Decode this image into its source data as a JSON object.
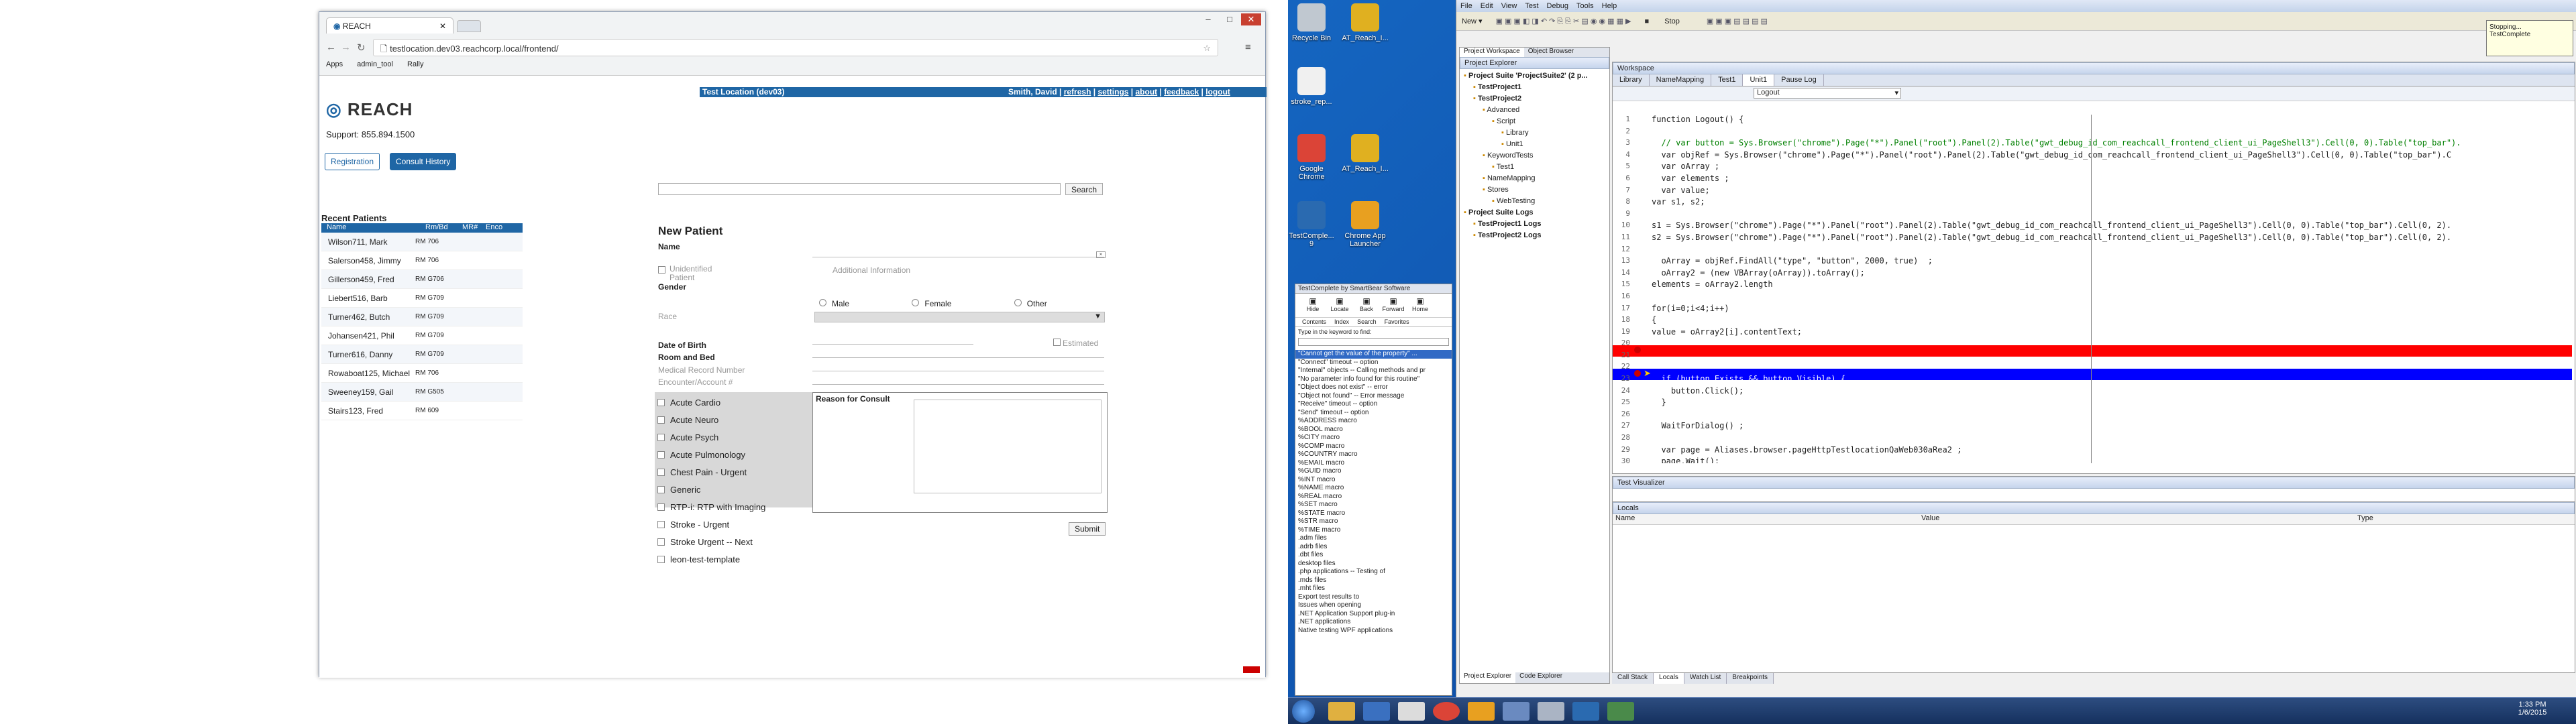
{
  "browser": {
    "tab_title": "REACH",
    "address": "testlocation.dev03.reachcorp.local/frontend/",
    "bookmarks": [
      "Apps",
      "admin_tool",
      "Rally"
    ]
  },
  "reach": {
    "location_banner": "Test Location (dev03)",
    "user_links": [
      "Smith, David",
      "refresh",
      "settings",
      "about",
      "feedback",
      "logout"
    ],
    "logo": "REACH",
    "support": "Support: 855.894.1500",
    "nav": {
      "registration": "Registration",
      "consult_history": "Consult History"
    },
    "search_label": "Search",
    "recent_patients": {
      "title": "Recent Patients",
      "headers": [
        "Name",
        "Rm/Bd",
        "MR#",
        "Enco"
      ],
      "rows": [
        {
          "name": "Wilson711, Mark",
          "room": "RM 706"
        },
        {
          "name": "Salerson458, Jimmy",
          "room": "RM 706"
        },
        {
          "name": "Gillerson459, Fred",
          "room": "RM G706"
        },
        {
          "name": "Liebert516, Barb",
          "room": "RM G709"
        },
        {
          "name": "Turner462, Butch",
          "room": "RM G709"
        },
        {
          "name": "Johansen421, Phil",
          "room": "RM G709"
        },
        {
          "name": "Turner616, Danny",
          "room": "RM G709"
        },
        {
          "name": "Rowaboat125, Michael",
          "room": "RM 706"
        },
        {
          "name": "Sweeney159, Gail",
          "room": "RM G505"
        },
        {
          "name": "Stairs123, Fred",
          "room": "RM 609"
        }
      ]
    },
    "new_patient": {
      "title": "New Patient",
      "name": "Name",
      "unidentified": "Unidentified Patient",
      "additional_info": "Additional Information",
      "gender": "Gender",
      "genders": [
        "Male",
        "Female",
        "Other"
      ],
      "race": "Race",
      "dob": "Date of Birth",
      "estimated": "Estimated",
      "room_bed": "Room and Bed",
      "mrn": "Medical Record Number",
      "encounter": "Encounter/Account #",
      "reason": "Reason for Consult",
      "consults": [
        "Acute Cardio",
        "Acute Neuro",
        "Acute Psych",
        "Acute Pulmonology",
        "Chest Pain - Urgent",
        "Generic",
        "RTP-i: RTP with Imaging",
        "Stroke - Urgent",
        "Stroke Urgent -- Next",
        "leon-test-template"
      ],
      "submit": "Submit"
    }
  },
  "desktop_icons": [
    {
      "label": "Recycle Bin",
      "color": "#c0c8d0"
    },
    {
      "label": "AT_Reach_I...",
      "color": "#e0b020"
    },
    {
      "label": "stroke_rep...",
      "color": "#f0f0f0"
    },
    {
      "label": "Google Chrome",
      "color": "#db4437"
    },
    {
      "label": "AT_Reach_I...",
      "color": "#e0b020"
    },
    {
      "label": "TestComple... 9",
      "color": "#2a6ab0"
    },
    {
      "label": "Chrome App Launcher",
      "color": "#e8a020"
    }
  ],
  "help_panel": {
    "title": "TestComplete by SmartBear Software",
    "toolbar": [
      "Hide",
      "Locate",
      "Back",
      "Forward",
      "Home"
    ],
    "tabs": [
      "Contents",
      "Index",
      "Search",
      "Favorites"
    ],
    "prompt": "Type in the keyword to find:",
    "items": [
      "\"Cannot get the value of the property\" ...",
      "\"Connect\" timeout -- option",
      "\"Internal\" objects -- Calling methods and pr",
      "\"No parameter info found for this routine\"",
      "\"Object does not exist\" -- error",
      "\"Object not found\" -- Error message",
      "\"Receive\" timeout -- option",
      "\"Send\" timeout -- option",
      "%ADDRESS macro",
      "%BOOL macro",
      "%CITY macro",
      "%COMP macro",
      "%COUNTRY macro",
      "%EMAIL macro",
      "%GUID macro",
      "%INT macro",
      "%NAME macro",
      "%REAL macro",
      "%SET macro",
      "%STATE macro",
      "%STR macro",
      "%TIME macro",
      ".adm files",
      ".adrb files",
      ".dbt files",
      "desktop files",
      ".php applications -- Testing of",
      ".mds files",
      ".mht files",
      "Export test results to",
      "Issues when opening",
      ".NET Application Support plug-in",
      ".NET applications",
      "Native testing WPF applications"
    ]
  },
  "testcomplete": {
    "menu": [
      "File",
      "Edit",
      "View",
      "Test",
      "Debug",
      "Tools",
      "Help"
    ],
    "stop_label": "Stop",
    "status_tooltip": "Stopping...",
    "status_sub": "TestComplete",
    "workspace_tabs": [
      "Project Workspace",
      "Object Browser"
    ],
    "explorer_title": "Project Explorer",
    "tree": [
      {
        "label": "Project Suite 'ProjectSuite2' (2 p...",
        "level": 0
      },
      {
        "label": "TestProject1",
        "level": 1
      },
      {
        "label": "TestProject2",
        "level": 1
      },
      {
        "label": "Advanced",
        "level": 2
      },
      {
        "label": "Script",
        "level": 3
      },
      {
        "label": "Library",
        "level": 4
      },
      {
        "label": "Unit1",
        "level": 4
      },
      {
        "label": "KeywordTests",
        "level": 2
      },
      {
        "label": "Test1",
        "level": 3
      },
      {
        "label": "NameMapping",
        "level": 2
      },
      {
        "label": "Stores",
        "level": 2
      },
      {
        "label": "WebTesting",
        "level": 3
      },
      {
        "label": "Project Suite Logs",
        "level": 0
      },
      {
        "label": "TestProject1 Logs",
        "level": 1
      },
      {
        "label": "TestProject2 Logs",
        "level": 1
      }
    ],
    "bottom_tabs_left": [
      "Project Explorer",
      "Code Explorer"
    ],
    "workspace_title": "Workspace",
    "editor_tabs": [
      "Library",
      "NameMapping",
      "Test1",
      "Unit1",
      "Pause Log"
    ],
    "routine": "Logout",
    "code_lines": [
      "function Logout() {",
      "",
      "  // var button = Sys.Browser(\"chrome\").Page(\"*\").Panel(\"root\").Panel(2).Table(\"gwt_debug_id_com_reachcall_frontend_client_ui_PageShell3\").Cell(0, 0).Table(\"top_bar\").",
      "  var objRef = Sys.Browser(\"chrome\").Page(\"*\").Panel(\"root\").Panel(2).Table(\"gwt_debug_id_com_reachcall_frontend_client_ui_PageShell3\").Cell(0, 0).Table(\"top_bar\").C",
      "  var oArray ;",
      "  var elements ;",
      "  var value;",
      "var s1, s2;",
      "",
      "s1 = Sys.Browser(\"chrome\").Page(\"*\").Panel(\"root\").Panel(2).Table(\"gwt_debug_id_com_reachcall_frontend_client_ui_PageShell3\").Cell(0, 0).Table(\"top_bar\").Cell(0, 2).",
      "s2 = Sys.Browser(\"chrome\").Page(\"*\").Panel(\"root\").Panel(2).Table(\"gwt_debug_id_com_reachcall_frontend_client_ui_PageShell3\").Cell(0, 0).Table(\"top_bar\").Cell(0, 2).",
      "",
      "  oArray = objRef.FindAll(\"type\", \"button\", 2000, true)  ;",
      "  oArray2 = (new VBArray(oArray)).toArray();",
      "elements = oArray2.length",
      "",
      "for(i=0;i<4;i++)",
      "{",
      "value = oArray2[i].contentText;",
      "",
      "",
      "",
      "  if (button.Exists && button.Visible) {",
      "    button.Click();",
      "  }",
      "",
      "  WaitForDialog() ;",
      "",
      "  var page = Aliases.browser.pageHttpTestlocationQaWeb030aRea2 ;",
      "  page.Wait();"
    ],
    "test_visualizer": "Test Visualizer",
    "locals_title": "Locals",
    "locals_headers": [
      "Name",
      "Value",
      "Type"
    ],
    "bottom_tabs": [
      "Call Stack",
      "Locals",
      "Watch List",
      "Breakpoints"
    ]
  },
  "taskbar": {
    "time": "1:33 PM",
    "date": "1/6/2015"
  }
}
